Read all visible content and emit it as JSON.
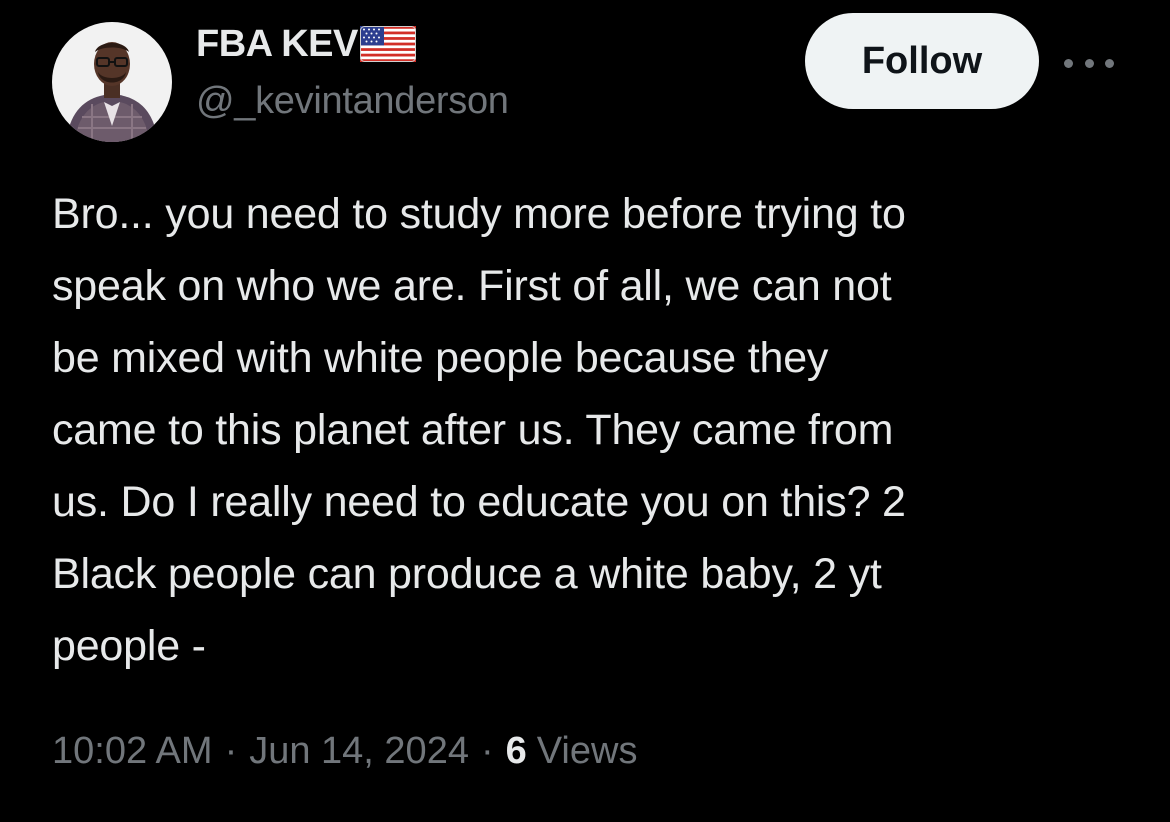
{
  "user": {
    "display_name": "FBA KEV",
    "handle": "@_kevintanderson",
    "flag_icon": "us-flag-icon"
  },
  "actions": {
    "follow_label": "Follow",
    "more_icon": "more-horizontal-icon"
  },
  "tweet": {
    "lines": [
      "Bro... you need to study more before trying to",
      "speak on who we are. First of all, we can not",
      "be mixed with white people because they",
      "came to this planet after us. They came from",
      "us. Do I really need to educate you on this? 2",
      "Black people can produce a white baby, 2 yt",
      "people -"
    ]
  },
  "meta": {
    "time": "10:02 AM",
    "separator": "·",
    "date": "Jun 14, 2024",
    "views_count": "6",
    "views_label": "Views"
  },
  "colors": {
    "background": "#000000",
    "primary_text": "#e7e9ea",
    "secondary_text": "#71767b",
    "follow_bg": "#eff3f4",
    "follow_text": "#0f1419"
  }
}
